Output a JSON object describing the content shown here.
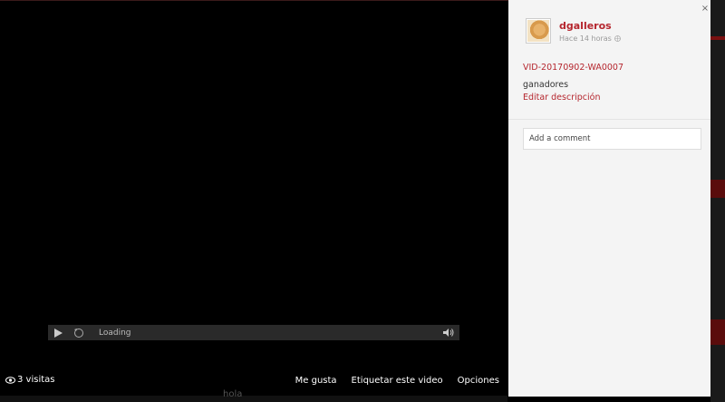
{
  "player": {
    "status": "Loading"
  },
  "footer": {
    "views": "3 visitas",
    "actions": [
      "Me gusta",
      "Etiquetar este video",
      "Opciones"
    ]
  },
  "background": {
    "peek_text": "hola"
  },
  "panel": {
    "close_label": "×",
    "username": "dgalleros",
    "time": "Hace 14 horas",
    "video_title": "VID-20170902-WA0007",
    "description": "ganadores",
    "edit_label": "Editar descripción",
    "comment_placeholder": "Add a comment"
  },
  "colors": {
    "accent": "#b5262e",
    "panel_bg": "#f4f4f4",
    "player_bar": "#2a2a2a"
  },
  "icons": [
    "play-icon",
    "replay-icon",
    "volume-icon",
    "eye-icon",
    "globe-icon",
    "close-icon"
  ]
}
